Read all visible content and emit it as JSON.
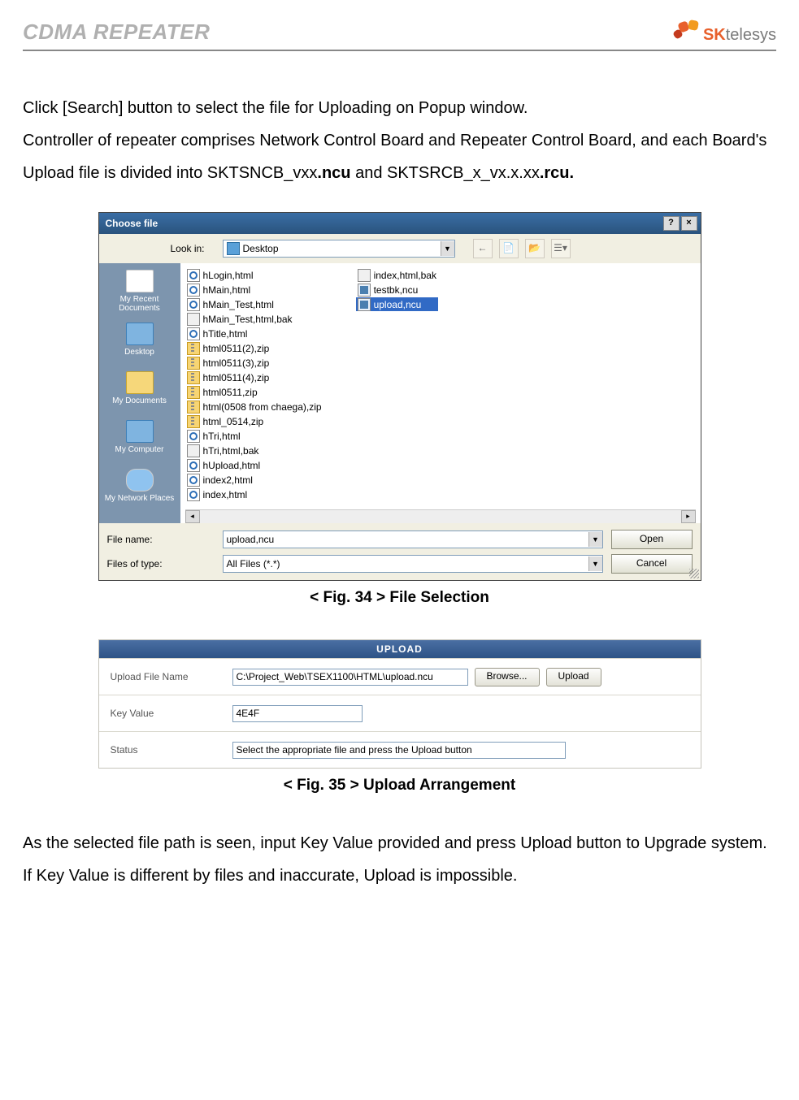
{
  "header": {
    "title": "CDMA REPEATER",
    "logo_sk": "SK",
    "logo_telesys": "telesys"
  },
  "intro": {
    "p1": "Click [Search] button to select the file for Uploading on Popup window.",
    "p2a": "Controller of repeater comprises Network Control Board and Repeater Control Board, and each Board's Upload file is divided into SKTSNCB_vxx",
    "p2b": ".ncu",
    "p2c": " and SKTSRCB_x_vx.x.xx",
    "p2d": ".rcu."
  },
  "fig34": {
    "caption": "< Fig. 34 > File Selection",
    "dialog_title": "Choose file",
    "help_btn": "?",
    "close_btn": "×",
    "lookin_label": "Look in:",
    "lookin_value": "Desktop",
    "back_icon": "←",
    "up_icon": "📄",
    "newfolder_icon": "📂",
    "views_icon": "☰▾",
    "places": [
      {
        "label": "My Recent Documents",
        "cls": ""
      },
      {
        "label": "Desktop",
        "cls": "comp"
      },
      {
        "label": "My Documents",
        "cls": "folder"
      },
      {
        "label": "My Computer",
        "cls": "comp"
      },
      {
        "label": "My Network Places",
        "cls": "globe"
      }
    ],
    "files_col1": [
      {
        "name": "hLogin,html",
        "icon": "ie"
      },
      {
        "name": "hMain,html",
        "icon": "ie"
      },
      {
        "name": "hMain_Test,html",
        "icon": "ie"
      },
      {
        "name": "hMain_Test,html,bak",
        "icon": "bak"
      },
      {
        "name": "hTitle,html",
        "icon": "ie"
      },
      {
        "name": "html0511(2),zip",
        "icon": "zip"
      },
      {
        "name": "html0511(3),zip",
        "icon": "zip"
      },
      {
        "name": "html0511(4),zip",
        "icon": "zip"
      },
      {
        "name": "html0511,zip",
        "icon": "zip"
      },
      {
        "name": "html(0508 from chaega),zip",
        "icon": "zip"
      },
      {
        "name": "html_0514,zip",
        "icon": "zip"
      },
      {
        "name": "hTri,html",
        "icon": "ie"
      },
      {
        "name": "hTri,html,bak",
        "icon": "bak"
      },
      {
        "name": "hUpload,html",
        "icon": "ie"
      },
      {
        "name": "index2,html",
        "icon": "ie"
      },
      {
        "name": "index,html",
        "icon": "ie"
      }
    ],
    "files_col2": [
      {
        "name": "index,html,bak",
        "icon": "bak",
        "sel": false
      },
      {
        "name": "testbk,ncu",
        "icon": "ncu",
        "sel": false
      },
      {
        "name": "upload,ncu",
        "icon": "ncu",
        "sel": true
      }
    ],
    "scroll_left": "◂",
    "scroll_right": "▸",
    "filename_label": "File name:",
    "filename_value": "upload,ncu",
    "filetype_label": "Files of type:",
    "filetype_value": "All Files (*.*)",
    "open_btn": "Open",
    "cancel_btn": "Cancel"
  },
  "fig35": {
    "caption": "< Fig. 35 > Upload Arrangement",
    "title": "UPLOAD",
    "row1_label": "Upload File Name",
    "row1_value": "C:\\Project_Web\\TSEX1100\\HTML\\upload.ncu",
    "browse_btn": "Browse...",
    "upload_btn": "Upload",
    "row2_label": "Key Value",
    "row2_value": "4E4F",
    "row3_label": "Status",
    "row3_value": "Select the appropriate file and press the Upload button"
  },
  "closing": {
    "p1": "As the selected file path is seen, input Key Value provided and press Upload button to Upgrade system.",
    "p2": "If Key Value is different by files and inaccurate, Upload is impossible."
  }
}
